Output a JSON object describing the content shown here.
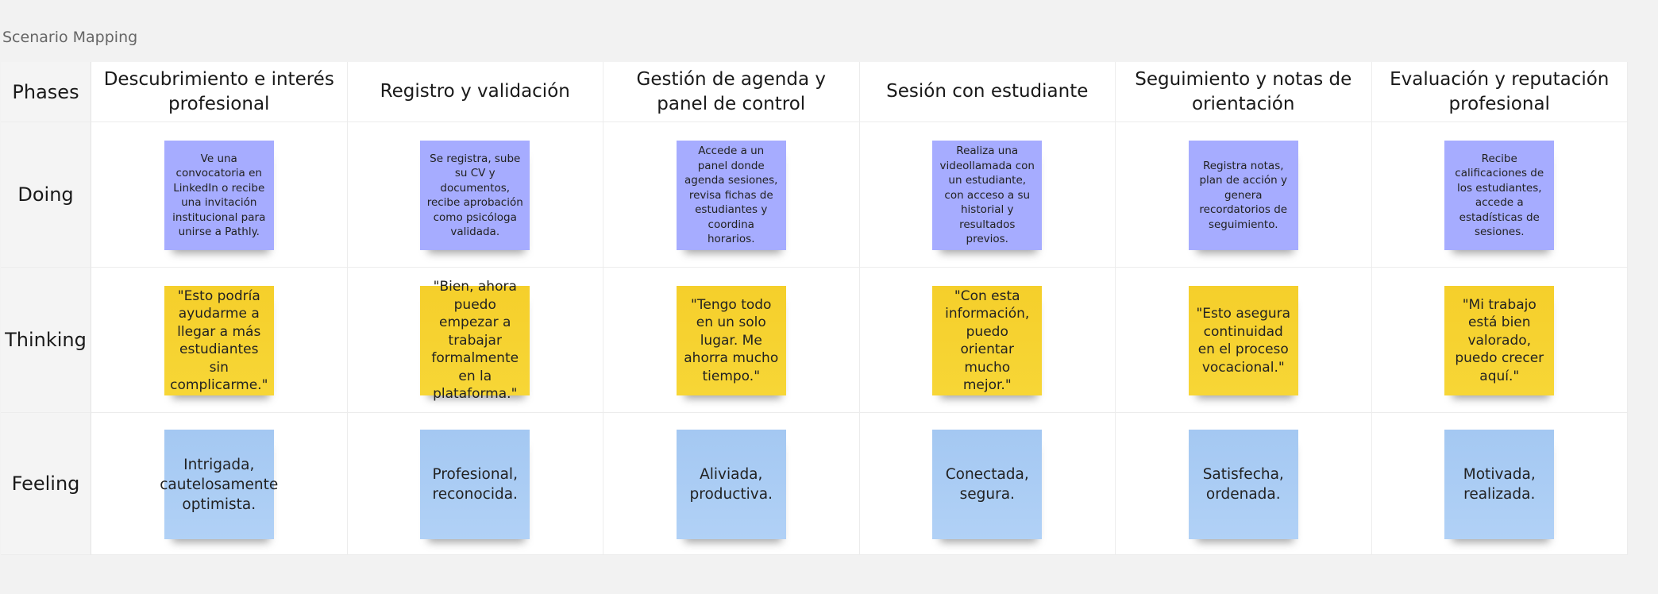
{
  "board": {
    "title": "Scenario Mapping"
  },
  "header": {
    "corner": "Phases",
    "phases": [
      "Descubrimiento e interés profesional",
      "Registro y validación",
      "Gestión de agenda y panel de control",
      "Sesión con estudiante",
      "Seguimiento y notas de orientación",
      "Evaluación y reputación profesional"
    ]
  },
  "rows": [
    {
      "label": "Doing",
      "note_color": "#a6acff",
      "notes": [
        "Ve una convocatoria en LinkedIn o recibe una invitación institucional para unirse a Pathly.",
        "Se registra, sube su CV y documentos, recibe aprobación como psicóloga validada.",
        "Accede a un panel donde agenda sesiones, revisa fichas de estudiantes y coordina horarios.",
        "Realiza una videollamada con un estudiante, con acceso a su historial y resultados previos.",
        "Registra notas, plan de acción y genera recordatorios de seguimiento.",
        "Recibe calificaciones de los estudiantes, accede a estadísticas de sesiones."
      ]
    },
    {
      "label": "Thinking",
      "note_color": "#f5cf2b",
      "notes": [
        "\"Esto podría ayudarme a llegar a más estudiantes sin complicarme.\"",
        "\"Bien, ahora puedo empezar a trabajar formalmente en la plataforma.\"",
        "\"Tengo todo en un solo lugar. Me ahorra mucho tiempo.\"",
        "\"Con esta información, puedo orientar mucho mejor.\"",
        "\"Esto asegura continuidad en el proceso vocacional.\"",
        "\"Mi trabajo está bien valorado, puedo crecer aquí.\""
      ]
    },
    {
      "label": "Feeling",
      "note_color": "#a4c8f2",
      "notes": [
        "Intrigada, cautelosamente optimista.",
        "Profesional, reconocida.",
        "Aliviada, productiva.",
        "Conectada, segura.",
        "Satisfecha, ordenada.",
        "Motivada, realizada."
      ]
    }
  ]
}
